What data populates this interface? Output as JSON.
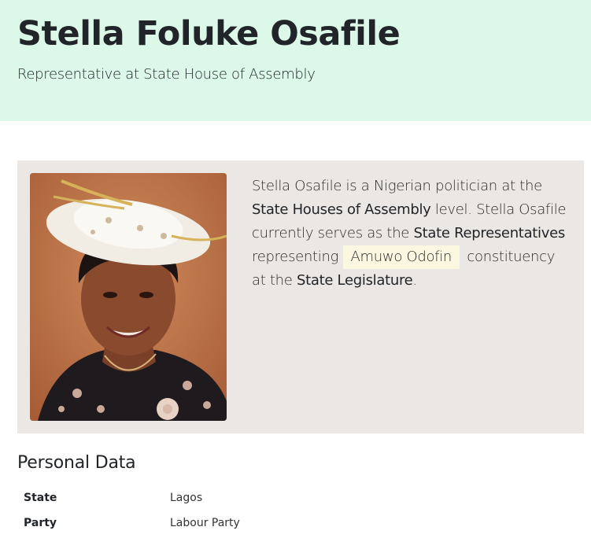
{
  "profile": {
    "name": "Stella Foluke Osafile",
    "role": "Representative at State House of Assembly"
  },
  "bio": {
    "t1": "Stella Osafile is a Nigerian politician at the ",
    "b1": "State Houses of Assembly",
    "t2": " level. Stella Osafile currently serves as the ",
    "b2": "State Representatives",
    "t3": " representing ",
    "constituency": "Amuwo Odofin",
    "t4": " constituency at the ",
    "b3": "State Legislature",
    "t5": "."
  },
  "personal_data": {
    "title": "Personal Data",
    "rows": [
      {
        "label": "State",
        "value": "Lagos"
      },
      {
        "label": "Party",
        "value": "Labour Party"
      }
    ]
  },
  "colors": {
    "header_bg": "#dcf8e9",
    "card_bg": "#ebe7e4",
    "constituency_bg": "#fbf7e1"
  }
}
